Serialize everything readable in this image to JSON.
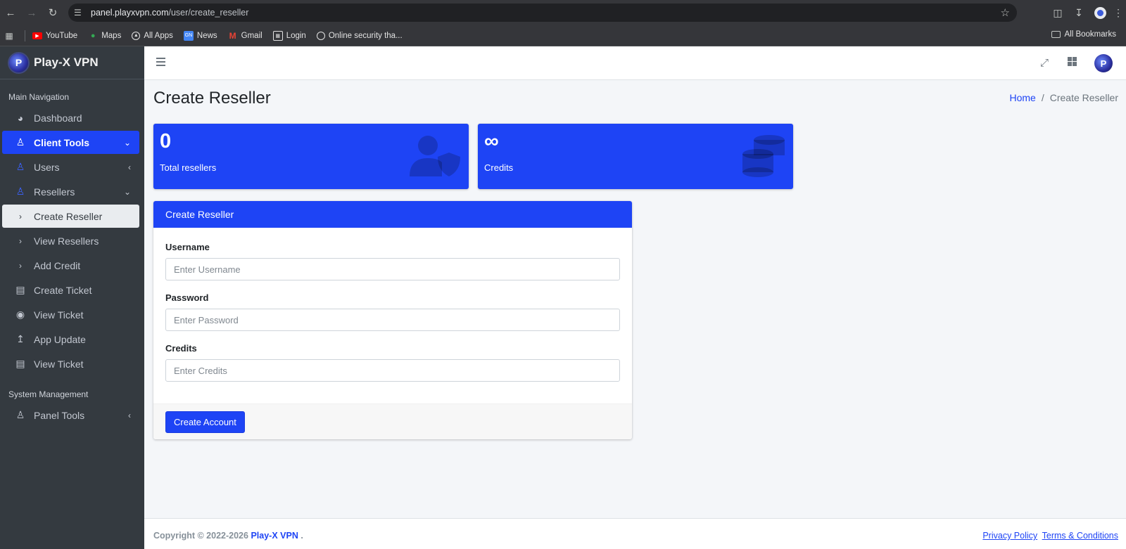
{
  "browser": {
    "url_host": "panel.playxvpn.com",
    "url_path": "/user/create_reseller",
    "bookmarks": [
      {
        "label": "YouTube",
        "icon": "youtube-icon",
        "color": "#ff0000"
      },
      {
        "label": "Maps",
        "icon": "maps-pin-icon",
        "color": "#34a853"
      },
      {
        "label": "All Apps",
        "icon": "apps-icon",
        "color": "#e3e3e3"
      },
      {
        "label": "News",
        "icon": "google-news-icon",
        "color": "#4285f4"
      },
      {
        "label": "Gmail",
        "icon": "gmail-icon",
        "color": "#ea4335"
      },
      {
        "label": "Login",
        "icon": "login-grid-icon",
        "color": "#e3e3e3"
      },
      {
        "label": "Online security tha...",
        "icon": "globe-icon",
        "color": "#e3e3e3"
      }
    ],
    "all_bookmarks": "All Bookmarks"
  },
  "sidebar": {
    "brand": "Play-X VPN",
    "logo_letter": "P",
    "header_main": "Main Navigation",
    "header_system": "System Management",
    "items": [
      {
        "label": "Dashboard",
        "icon": "pie-chart-icon"
      },
      {
        "label": "Client Tools",
        "icon": "user-icon"
      },
      {
        "label": "Users",
        "icon": "user-outline-icon"
      },
      {
        "label": "Resellers",
        "icon": "user-outline-icon"
      },
      {
        "label": "Create Reseller",
        "icon": "chevron-right-icon"
      },
      {
        "label": "View Resellers",
        "icon": "chevron-right-icon"
      },
      {
        "label": "Add Credit",
        "icon": "chevron-right-icon"
      },
      {
        "label": "Create Ticket",
        "icon": "ticket-icon"
      },
      {
        "label": "View Ticket",
        "icon": "eye-icon"
      },
      {
        "label": "App Update",
        "icon": "upload-icon"
      },
      {
        "label": "View Ticket",
        "icon": "ticket-icon"
      },
      {
        "label": "Panel Tools",
        "icon": "user-icon"
      }
    ]
  },
  "page": {
    "title": "Create Reseller",
    "breadcrumb_home": "Home",
    "breadcrumb_current": "Create Reseller"
  },
  "stats": [
    {
      "value": "0",
      "label": "Total resellers",
      "icon": "user-shield-icon"
    },
    {
      "value": "∞",
      "label": "Credits",
      "icon": "coins-icon"
    }
  ],
  "form": {
    "header": "Create Reseller",
    "username_label": "Username",
    "username_placeholder": "Enter Username",
    "password_label": "Password",
    "password_placeholder": "Enter Password",
    "credits_label": "Credits",
    "credits_placeholder": "Enter Credits",
    "submit_label": "Create Account"
  },
  "footer": {
    "copyright": "Copyright © 2022-2026",
    "brand": "Play-X VPN",
    "dot": ".",
    "privacy": "Privacy Policy",
    "terms": "Terms & Conditions"
  },
  "colors": {
    "primary": "#1e44f5",
    "sidebar_bg": "#343a40",
    "content_bg": "#f4f6f9"
  }
}
